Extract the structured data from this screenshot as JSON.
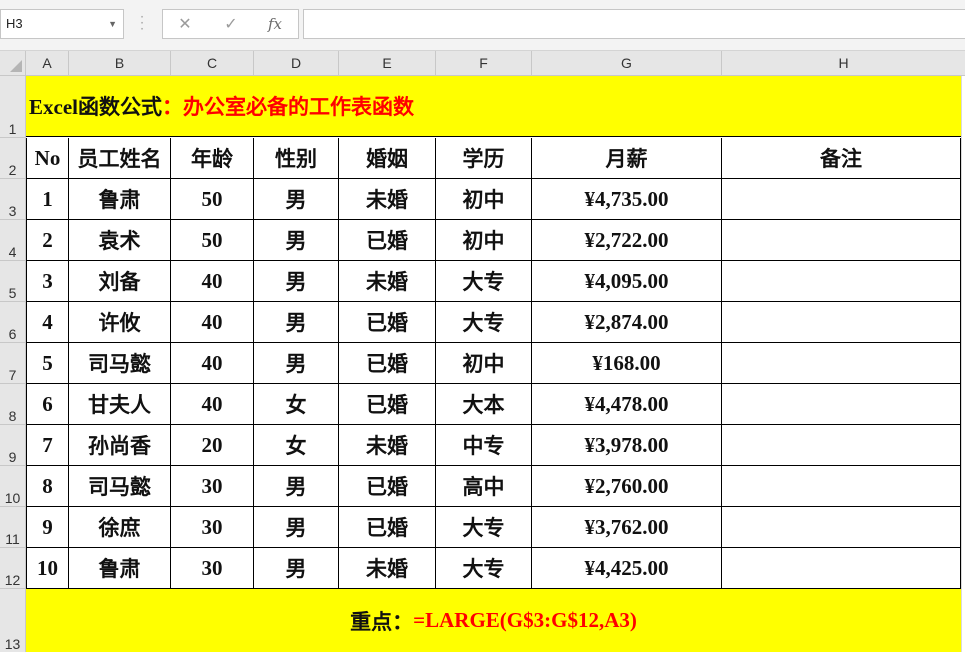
{
  "formula_bar": {
    "name_box": "H3",
    "cancel_icon": "✕",
    "enter_icon": "✓",
    "fx_label": "fx",
    "formula": ""
  },
  "columns": [
    "A",
    "B",
    "C",
    "D",
    "E",
    "F",
    "G",
    "H"
  ],
  "rows": [
    "1",
    "2",
    "3",
    "4",
    "5",
    "6",
    "7",
    "8",
    "9",
    "10",
    "11",
    "12",
    "13"
  ],
  "title": {
    "part1": "Excel函数公式",
    "part2": "：办公室必备的工作表函数"
  },
  "headers": [
    "No",
    "员工姓名",
    "年龄",
    "性别",
    "婚姻",
    "学历",
    "月薪",
    "备注"
  ],
  "data": [
    [
      "1",
      "鲁肃",
      "50",
      "男",
      "未婚",
      "初中",
      "¥4,735.00",
      ""
    ],
    [
      "2",
      "袁术",
      "50",
      "男",
      "已婚",
      "初中",
      "¥2,722.00",
      ""
    ],
    [
      "3",
      "刘备",
      "40",
      "男",
      "未婚",
      "大专",
      "¥4,095.00",
      ""
    ],
    [
      "4",
      "许攸",
      "40",
      "男",
      "已婚",
      "大专",
      "¥2,874.00",
      ""
    ],
    [
      "5",
      "司马懿",
      "40",
      "男",
      "已婚",
      "初中",
      "¥168.00",
      ""
    ],
    [
      "6",
      "甘夫人",
      "40",
      "女",
      "已婚",
      "大本",
      "¥4,478.00",
      ""
    ],
    [
      "7",
      "孙尚香",
      "20",
      "女",
      "未婚",
      "中专",
      "¥3,978.00",
      ""
    ],
    [
      "8",
      "司马懿",
      "30",
      "男",
      "已婚",
      "高中",
      "¥2,760.00",
      ""
    ],
    [
      "9",
      "徐庶",
      "30",
      "男",
      "已婚",
      "大专",
      "¥3,762.00",
      ""
    ],
    [
      "10",
      "鲁肃",
      "30",
      "男",
      "未婚",
      "大专",
      "¥4,425.00",
      ""
    ]
  ],
  "footer": {
    "label": "重点：",
    "formula": "=LARGE(G$3:G$12,A3)"
  },
  "colors": {
    "highlight": "#ffff00",
    "accent_red": "#ff0000"
  }
}
